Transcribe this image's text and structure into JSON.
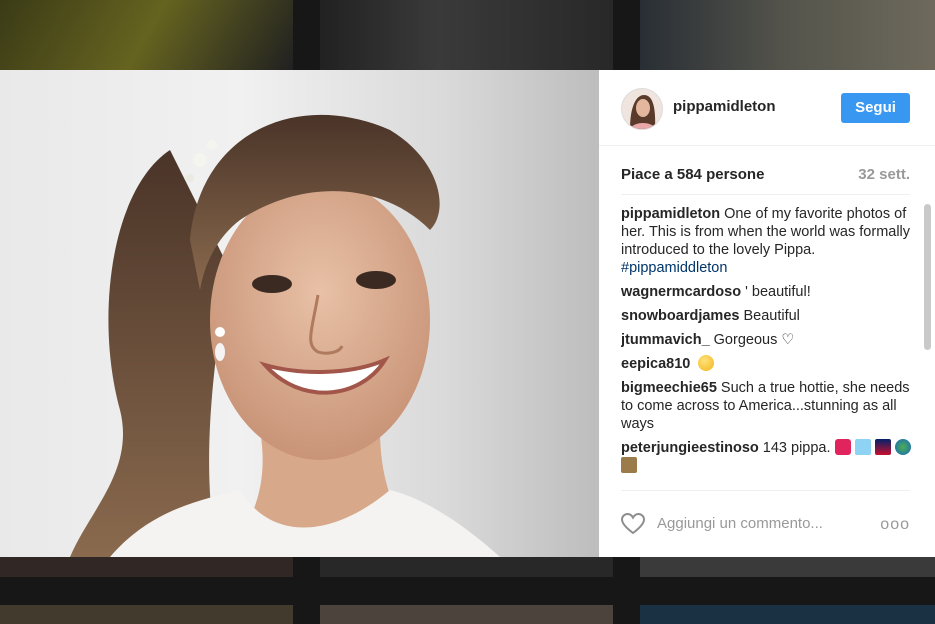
{
  "post": {
    "username": "pippamidleton",
    "follow_label": "Segui",
    "likes": "Piace a 584 persone",
    "time": "32 sett.",
    "comments": [
      {
        "user": "pippamidleton",
        "text": "One of my favorite photos of her. This is from when the world was formally introduced to the lovely Pippa.",
        "hashtag": "#pippamiddleton"
      },
      {
        "user": "wagnermcardoso",
        "text": "' beautiful!"
      },
      {
        "user": "snowboardjames",
        "text": "Beautiful"
      },
      {
        "user": "jtummavich_",
        "text": "Gorgeous ♡"
      },
      {
        "user": "eepica810",
        "text": ""
      },
      {
        "user": "bigmeechie65",
        "text": "Such a true hottie, she needs to come across to America...stunning as all ways"
      },
      {
        "user": "peterjungieestinoso",
        "text": "143 pippa."
      }
    ],
    "add_comment_placeholder": "Aggiungi un commento...",
    "more_label": "ooo"
  },
  "icons": {
    "heart": "heart-outline-icon",
    "more": "more-options-icon",
    "emoji": "smiley-emoji"
  },
  "colors": {
    "accent": "#3897f0",
    "hashtag": "#003569",
    "muted": "#999999"
  }
}
